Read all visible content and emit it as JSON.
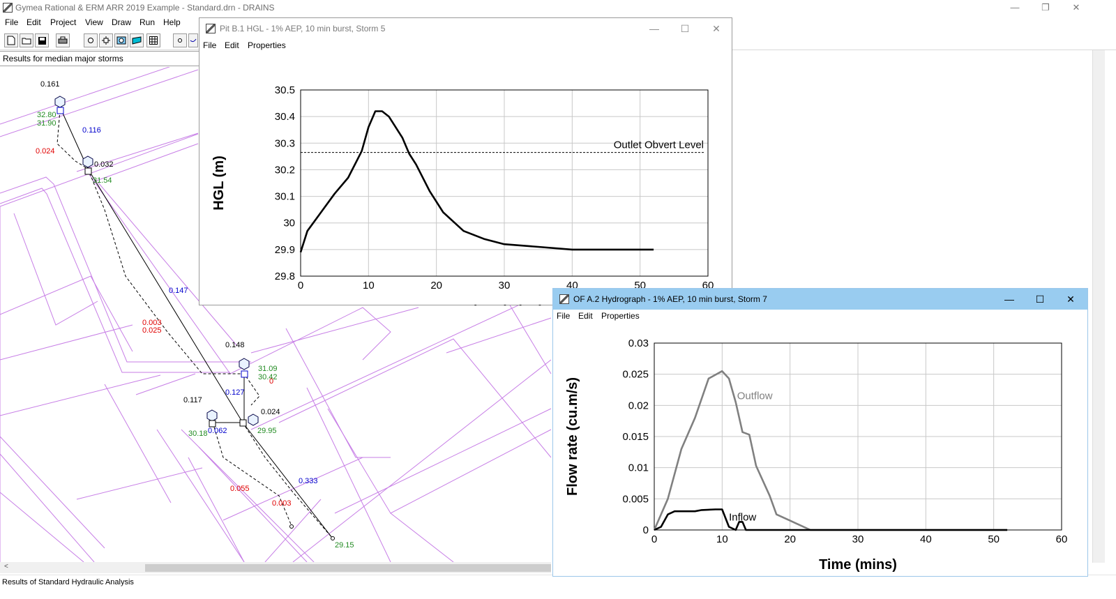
{
  "app": {
    "title": "Gymea Rational & ERM ARR 2019 Example - Standard.drn - DRAINS",
    "minimize_glyph": "—",
    "restore_glyph": "❐",
    "close_glyph": "✕"
  },
  "menu": [
    "File",
    "Edit",
    "Project",
    "View",
    "Draw",
    "Run",
    "Help"
  ],
  "toolbar_icons": [
    "new-file-icon",
    "open-folder-icon",
    "save-icon",
    "print-icon",
    "node-icon",
    "pit-icon",
    "storage-icon",
    "channel-icon",
    "grid-icon",
    "node-small-icon",
    "link-icon"
  ],
  "results_header": "Results for median major storms",
  "status": "Results of Standard Hydraulic Analysis",
  "network_labels": {
    "black": [
      "0.161",
      "0.032",
      "0.148",
      "0.117",
      "0.024"
    ],
    "blue": [
      "0.116",
      "0.147",
      "0.127",
      "0.062",
      "0.333"
    ],
    "green": [
      "32.80",
      "31.90",
      "31.54",
      "31.09",
      "30.42",
      "30.18",
      "29.95",
      "29.15"
    ],
    "red": [
      "0.024",
      "0.003",
      "0.025",
      "0",
      "0.055",
      "0.003"
    ]
  },
  "hgl_window": {
    "title": "Pit B.1 HGL  - 1% AEP, 10 min burst, Storm 5",
    "menu": [
      "File",
      "Edit",
      "Properties"
    ]
  },
  "hyd_window": {
    "title": "OF A.2 Hydrograph - 1% AEP, 10 min burst, Storm 7",
    "menu": [
      "File",
      "Edit",
      "Properties"
    ]
  },
  "chart_data": [
    {
      "type": "line",
      "xlabel": "Time (mins)",
      "ylabel": "HGL (m)",
      "xlim": [
        0,
        60
      ],
      "ylim": [
        29.8,
        30.5
      ],
      "x_ticks": [
        "0",
        "10",
        "20",
        "30",
        "40",
        "50",
        "60"
      ],
      "y_ticks": [
        "29.8",
        "29.9",
        "30",
        "30.1",
        "30.2",
        "30.3",
        "30.4",
        "30.5"
      ],
      "grid": true,
      "series": [
        {
          "x": [
            0,
            1,
            3,
            5,
            7,
            9,
            10,
            11,
            12,
            13,
            15,
            16,
            17,
            19,
            21,
            24,
            27,
            30,
            35,
            40,
            45,
            52
          ],
          "y": [
            29.89,
            29.97,
            30.04,
            30.11,
            30.17,
            30.27,
            30.36,
            30.42,
            30.42,
            30.4,
            30.32,
            30.26,
            30.22,
            30.12,
            30.04,
            29.97,
            29.94,
            29.92,
            29.91,
            29.9,
            29.9,
            29.9
          ]
        }
      ],
      "reference_line": {
        "y": 30.265,
        "label": "Outlet Obvert Level"
      }
    },
    {
      "type": "line",
      "xlabel": "Time (mins)",
      "ylabel": "Flow rate (cu.m/s)",
      "xlim": [
        0,
        60
      ],
      "ylim": [
        0,
        0.03
      ],
      "x_ticks": [
        "0",
        "10",
        "20",
        "30",
        "40",
        "50",
        "60"
      ],
      "y_ticks": [
        "0",
        "0.005",
        "0.01",
        "0.015",
        "0.02",
        "0.025",
        "0.03"
      ],
      "grid": true,
      "series": [
        {
          "name": "Outflow",
          "color": "#808080",
          "x": [
            0,
            2,
            4,
            6,
            8,
            10,
            11,
            12,
            13,
            14,
            15,
            17,
            18,
            20,
            23,
            24,
            52
          ],
          "y": [
            0,
            0.005,
            0.013,
            0.018,
            0.0243,
            0.0255,
            0.0243,
            0.0205,
            0.0157,
            0.0153,
            0.0103,
            0.0055,
            0.0025,
            0.0015,
            0.0,
            0.0,
            0.0
          ]
        },
        {
          "name": "Inflow",
          "color": "#000000",
          "x": [
            0,
            1,
            2,
            3,
            6,
            7,
            9,
            10,
            11,
            12,
            12.5,
            13,
            13.5,
            14,
            52
          ],
          "y": [
            0,
            0.0005,
            0.0025,
            0.003,
            0.003,
            0.0032,
            0.0033,
            0.0033,
            0.0005,
            0,
            0.0013,
            0.0013,
            0.0,
            0,
            0
          ]
        }
      ]
    }
  ]
}
